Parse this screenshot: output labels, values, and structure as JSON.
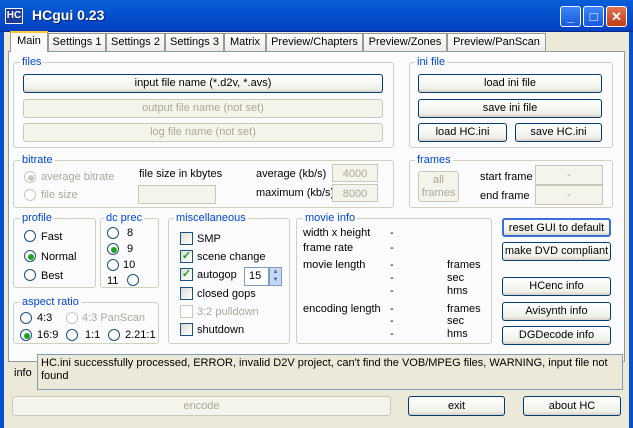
{
  "window": {
    "icon": "HC",
    "title": "HCgui 0.23"
  },
  "tabs": [
    "Main",
    "Settings 1",
    "Settings 2",
    "Settings 3",
    "Matrix",
    "Preview/Chapters",
    "Preview/Zones",
    "Preview/PanScan"
  ],
  "files": {
    "legend": "files",
    "input_button": "input file name (*.d2v, *.avs)",
    "output_button": "output file name (not set)",
    "log_button": "log file name (not set)"
  },
  "ini_file": {
    "legend": "ini file",
    "load_ini": "load ini file",
    "save_ini": "save ini file",
    "load_hc": "load HC.ini",
    "save_hc": "save HC.ini"
  },
  "bitrate": {
    "legend": "bitrate",
    "average_bitrate": "average bitrate",
    "file_size": "file size",
    "file_size_kbytes": "file size in kbytes",
    "average_label": "average (kb/s)",
    "average_value": "4000",
    "maximum_label": "maximum (kb/s)",
    "maximum_value": "8000"
  },
  "frames": {
    "legend": "frames",
    "all_frames": "all frames",
    "start_frame": "start frame",
    "start_value": "-",
    "end_frame": "end frame",
    "end_value": "-"
  },
  "profile": {
    "legend": "profile",
    "options": [
      "Fast",
      "Normal",
      "Best"
    ],
    "selected": "Normal"
  },
  "dc_prec": {
    "legend": "dc prec",
    "options": [
      "8",
      "9",
      "10",
      "11"
    ],
    "selected": "9"
  },
  "misc": {
    "legend": "miscellaneous",
    "smp": "SMP",
    "scene_change": "scene change",
    "autogop": "autogop",
    "autogop_value": "15",
    "closed_gops": "closed gops",
    "pulldown": "3:2 pulldown",
    "shutdown": "shutdown"
  },
  "movie_info": {
    "legend": "movie info",
    "width_height": "width x height",
    "frame_rate": "frame rate",
    "movie_length": "movie length",
    "encoding_length": "encoding length",
    "dash": "-",
    "frames": "frames",
    "sec": "sec",
    "hms": "hms"
  },
  "aspect": {
    "legend": "aspect ratio",
    "options": [
      "4:3",
      "4:3 PanScan",
      "16:9",
      "1:1",
      "2.21:1"
    ],
    "selected": "16:9"
  },
  "right_buttons": {
    "reset": "reset GUI to default",
    "dvd": "make DVD compliant",
    "hcenc": "HCenc info",
    "avisynth": "Avisynth info",
    "dgdecode": "DGDecode info"
  },
  "info": {
    "label": "info",
    "message": "HC.ini successfully processed, ERROR, invalid D2V project, can't find the VOB/MPEG files, WARNING, input file not found"
  },
  "bottom": {
    "encode": "encode",
    "exit": "exit",
    "about": "about HC"
  },
  "colors": {
    "titlebar": "#0450D0",
    "legend": "#0046D5",
    "accent_tab": "#FFC83C",
    "check": "#21A121"
  }
}
